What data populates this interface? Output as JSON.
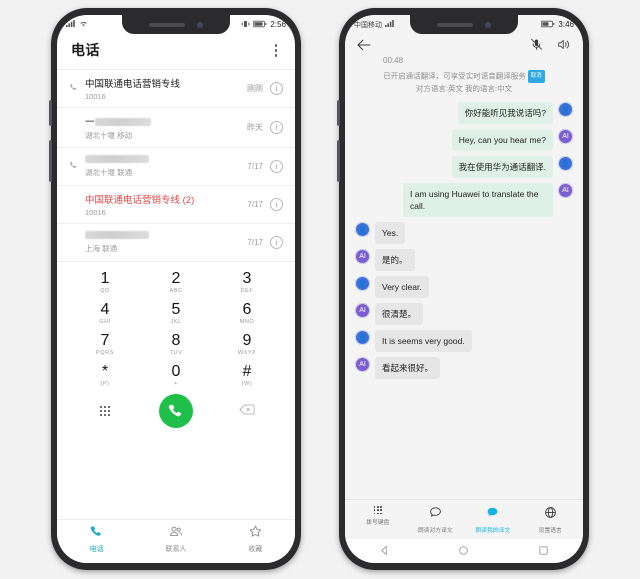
{
  "left_phone": {
    "status_bar": {
      "signal_icon": "signal-icon",
      "wifi_icon": "wifi-icon",
      "vibrate_icon": "vibrate-icon",
      "battery_icon": "battery-icon",
      "time": "2:56"
    },
    "header": {
      "title": "电话",
      "menu_icon": "kebab-menu-icon"
    },
    "call_log": [
      {
        "name": "中国联通电话营销专线",
        "sub": "10016",
        "time": "刚刚",
        "missed": false,
        "has_call_icon": true,
        "blurred_name": false,
        "blurred_sub": false
      },
      {
        "name": "一",
        "sub": "湖北十堰 移动",
        "time": "昨天",
        "missed": false,
        "has_call_icon": false,
        "blurred_name": true,
        "blurred_sub": false
      },
      {
        "name": "",
        "sub": "湖北十堰 联通",
        "time": "7/17",
        "missed": false,
        "has_call_icon": true,
        "blurred_name": true,
        "blurred_sub": false
      },
      {
        "name": "中国联通电话营销专线 (2)",
        "sub": "10016",
        "time": "7/17",
        "missed": true,
        "has_call_icon": false,
        "blurred_name": false,
        "blurred_sub": false
      },
      {
        "name": "",
        "sub": "上海 联通",
        "time": "7/17",
        "missed": false,
        "has_call_icon": false,
        "blurred_name": true,
        "blurred_sub": false
      }
    ],
    "keypad": [
      {
        "digit": "1",
        "letters": "QD"
      },
      {
        "digit": "2",
        "letters": "ABC"
      },
      {
        "digit": "3",
        "letters": "DEF"
      },
      {
        "digit": "4",
        "letters": "GHI"
      },
      {
        "digit": "5",
        "letters": "JKL"
      },
      {
        "digit": "6",
        "letters": "MNO"
      },
      {
        "digit": "7",
        "letters": "PQRS"
      },
      {
        "digit": "8",
        "letters": "TUV"
      },
      {
        "digit": "9",
        "letters": "WXYZ"
      },
      {
        "digit": "*",
        "letters": "(P)"
      },
      {
        "digit": "0",
        "letters": "+"
      },
      {
        "digit": "#",
        "letters": "(W)"
      }
    ],
    "keypad_actions": {
      "hide_keypad_icon": "dialpad-icon",
      "call_icon": "phone-handset-icon",
      "delete_icon": "backspace-icon",
      "call_button_color": "#1fc04a"
    },
    "tabs": [
      {
        "label": "电话",
        "icon": "phone-icon",
        "active": true
      },
      {
        "label": "联系人",
        "icon": "contacts-icon",
        "active": false
      },
      {
        "label": "收藏",
        "icon": "star-icon",
        "active": false
      }
    ],
    "accent_color": "#1aa7d0",
    "missed_color": "#e04a4a"
  },
  "right_phone": {
    "status_bar": {
      "carrier": "中国移动",
      "battery_icon": "battery-icon",
      "time": "3:46"
    },
    "header": {
      "back_icon": "back-arrow-icon",
      "mute_icon": "mic-muted-icon",
      "speaker_icon": "speaker-icon",
      "timer": "00:48"
    },
    "banner": {
      "line1": "已开启通话翻译，可享受实时语音翻译服务",
      "badge": "取消",
      "line2": "对方语言:英文 我的语言:中文",
      "badge_color": "#2fa8e8"
    },
    "messages": [
      {
        "side": "out",
        "avatar": "person",
        "text": "你好能听见我说话吗?"
      },
      {
        "side": "out",
        "avatar": "ai",
        "text": "Hey, can you hear me?"
      },
      {
        "side": "out",
        "avatar": "person",
        "text": "我在使用华为通话翻译."
      },
      {
        "side": "out",
        "avatar": "ai",
        "text": "I am using Huawei to translate the call."
      },
      {
        "side": "in",
        "avatar": "person",
        "text": "Yes."
      },
      {
        "side": "in",
        "avatar": "ai",
        "text": "是的。"
      },
      {
        "side": "in",
        "avatar": "person",
        "text": "Very clear."
      },
      {
        "side": "in",
        "avatar": "ai",
        "text": "很清楚。"
      },
      {
        "side": "in",
        "avatar": "person",
        "text": "It is seems very good."
      },
      {
        "side": "in",
        "avatar": "ai",
        "text": "看起来很好。"
      }
    ],
    "tools": [
      {
        "label": "拨号键盘",
        "icon": "dialpad-icon",
        "active": false
      },
      {
        "label": "朗读对方译文",
        "icon": "speech-bubble-icon",
        "active": false
      },
      {
        "label": "朗读我的译文",
        "icon": "speech-bubble-filled-icon",
        "active": true
      },
      {
        "label": "设置语言",
        "icon": "globe-icon",
        "active": false
      }
    ],
    "nav_bar": [
      {
        "icon": "android-back-icon"
      },
      {
        "icon": "android-home-icon"
      },
      {
        "icon": "android-recents-icon"
      }
    ],
    "accent_color": "#13b5e6",
    "out_bubble_color": "#dff0e9",
    "in_bubble_color": "#e6e6e6"
  }
}
